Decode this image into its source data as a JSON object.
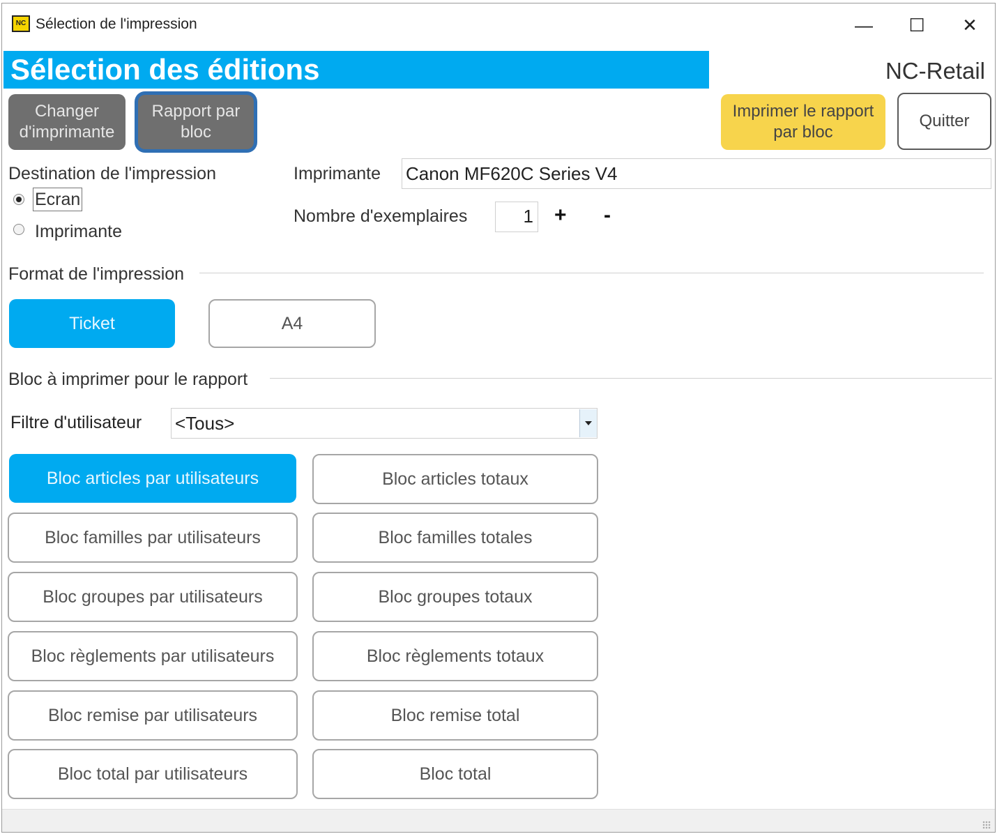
{
  "window": {
    "app_icon_text": "NC",
    "title": "Sélection de l'impression",
    "minimize": "—",
    "maximize": "☐",
    "close": "✕"
  },
  "header": {
    "title": "Sélection des éditions",
    "brand": "NC-Retail",
    "accent_color": "#00aaf0"
  },
  "toolbar": {
    "change_printer": "Changer d'imprimante",
    "report_by_block": "Rapport par bloc",
    "print_report": "Imprimer le rapport par bloc",
    "quit": "Quitter"
  },
  "destination": {
    "label": "Destination de l'impression",
    "options": [
      "Ecran",
      "Imprimante"
    ],
    "selected": "Ecran"
  },
  "printer": {
    "label": "Imprimante",
    "value": "Canon MF620C Series V4"
  },
  "copies": {
    "label": "Nombre d'exemplaires",
    "value": "1",
    "plus": "+",
    "minus": "-"
  },
  "format": {
    "section_label": "Format de l'impression",
    "options": [
      "Ticket",
      "A4"
    ],
    "selected": "Ticket"
  },
  "blocks": {
    "section_label": "Bloc à imprimer pour le rapport",
    "filter_label": "Filtre d'utilisateur",
    "filter_value": "<Tous>",
    "selected": "Bloc articles par utilisateurs",
    "left": [
      "Bloc articles par utilisateurs",
      "Bloc familles par utilisateurs",
      "Bloc groupes par utilisateurs",
      "Bloc règlements par utilisateurs",
      "Bloc remise par utilisateurs",
      "Bloc total par utilisateurs"
    ],
    "right": [
      "Bloc articles totaux",
      "Bloc familles totales",
      "Bloc groupes totaux",
      "Bloc règlements totaux",
      "Bloc remise total",
      "Bloc total"
    ]
  }
}
